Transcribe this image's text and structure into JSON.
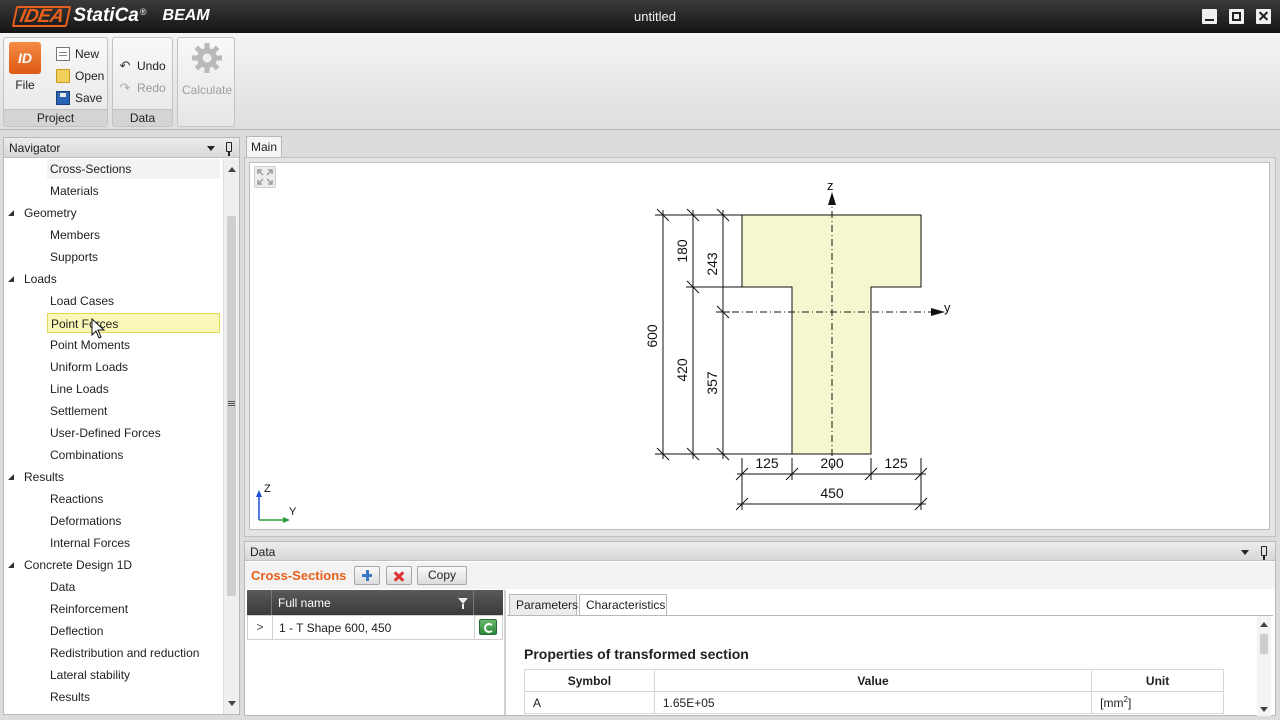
{
  "window": {
    "brand_idea": "IDEA",
    "brand_statica": "StatiCa",
    "brand_reg": "®",
    "product": "BEAM",
    "title": "untitled"
  },
  "ribbon": {
    "file_label": "File",
    "file_icon_text": "ID",
    "new_label": "New",
    "open_label": "Open",
    "save_label": "Save",
    "project_group": "Project",
    "undo_label": "Undo",
    "redo_label": "Redo",
    "data_group": "Data",
    "calculate_label": "Calculate"
  },
  "navigator": {
    "title": "Navigator",
    "items": [
      {
        "label": "Cross-Sections",
        "level": 1,
        "state": "current"
      },
      {
        "label": "Materials",
        "level": 1
      },
      {
        "label": "Geometry",
        "level": 0
      },
      {
        "label": "Members",
        "level": 1
      },
      {
        "label": "Supports",
        "level": 1
      },
      {
        "label": "Loads",
        "level": 0
      },
      {
        "label": "Load Cases",
        "level": 1
      },
      {
        "label": "Point Forces",
        "level": 1,
        "state": "selected"
      },
      {
        "label": "Point Moments",
        "level": 1
      },
      {
        "label": "Uniform Loads",
        "level": 1
      },
      {
        "label": "Line Loads",
        "level": 1
      },
      {
        "label": "Settlement",
        "level": 1
      },
      {
        "label": "User-Defined Forces",
        "level": 1
      },
      {
        "label": "Combinations",
        "level": 1
      },
      {
        "label": "Results",
        "level": 0
      },
      {
        "label": "Reactions",
        "level": 1
      },
      {
        "label": "Deformations",
        "level": 1
      },
      {
        "label": "Internal Forces",
        "level": 1
      },
      {
        "label": "Concrete Design 1D",
        "level": 0
      },
      {
        "label": "Data",
        "level": 1
      },
      {
        "label": "Reinforcement",
        "level": 1
      },
      {
        "label": "Deflection",
        "level": 1
      },
      {
        "label": "Redistribution and reduction",
        "level": 1
      },
      {
        "label": "Lateral stability",
        "level": 1
      },
      {
        "label": "Results",
        "level": 1
      }
    ]
  },
  "main": {
    "tab_label": "Main"
  },
  "drawing": {
    "axis_z": "z",
    "axis_y": "y",
    "dim_flange_height": "180",
    "dim_centroid_top": "243",
    "dim_total_height": "600",
    "dim_web_height": "420",
    "dim_centroid_bottom": "357",
    "dim_left_flange": "125",
    "dim_web_width": "200",
    "dim_right_flange": "125",
    "dim_total_width": "450",
    "triad_z": "Z",
    "triad_y": "Y",
    "colors": {
      "section_fill": "#f7f7cf",
      "triad_z": "#1f4fd1",
      "triad_y": "#2e9e3c"
    }
  },
  "data_panel": {
    "title": "Data",
    "section_title": "Cross-Sections",
    "copy_label": "Copy",
    "grid_header": "Full name",
    "grid_expand": ">",
    "grid_row": "1 - T Shape 600, 450",
    "tab_parameters": "Parameters",
    "tab_characteristics": "Characteristics",
    "props_heading": "Properties of transformed section",
    "col_symbol": "Symbol",
    "col_value": "Value",
    "col_unit": "Unit",
    "row_symbol": "A",
    "row_value": "1.65E+05",
    "row_unit_base": "[mm",
    "row_unit_exp": "2",
    "row_unit_close": "]"
  },
  "accent_color": "#e8601c"
}
